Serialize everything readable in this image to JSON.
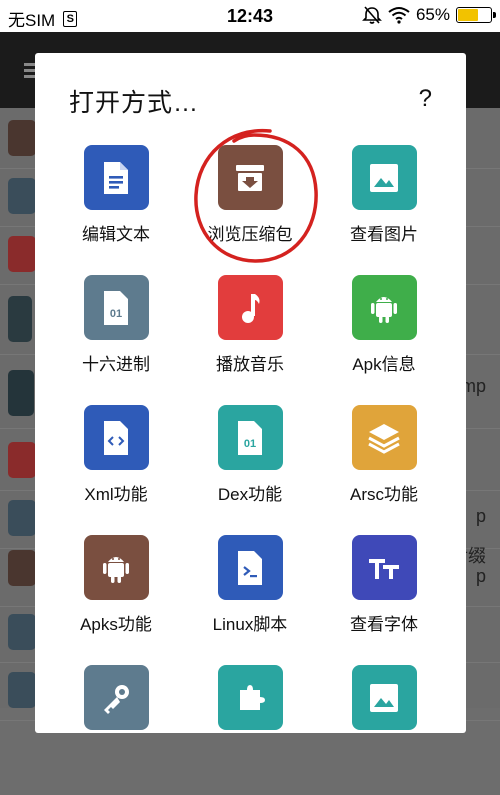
{
  "status_bar": {
    "carrier": "无SIM",
    "sim_badge": "S",
    "time": "12:43",
    "battery_text": "65%",
    "battery_level": 0.65
  },
  "background_app": {
    "partial_texts": [
      "mp",
      "p",
      "后缀",
      "p"
    ]
  },
  "dialog": {
    "title": "打开方式…",
    "help": "?",
    "items": [
      {
        "label": "编辑文本",
        "icon": "document-text-icon",
        "color": "#2f5bb8"
      },
      {
        "label": "浏览压缩包",
        "icon": "archive-icon",
        "color": "#7a4f40"
      },
      {
        "label": "查看图片",
        "icon": "image-icon",
        "color": "#2aa5a0"
      },
      {
        "label": "十六进制",
        "icon": "hex-file-icon",
        "color": "#5e7b8e"
      },
      {
        "label": "播放音乐",
        "icon": "music-note-icon",
        "color": "#e23d3d"
      },
      {
        "label": "Apk信息",
        "icon": "android-icon",
        "color": "#3fae4a"
      },
      {
        "label": "Xml功能",
        "icon": "xml-code-icon",
        "color": "#2f5bb8"
      },
      {
        "label": "Dex功能",
        "icon": "dex-file-icon",
        "color": "#2aa5a0"
      },
      {
        "label": "Arsc功能",
        "icon": "layers-icon",
        "color": "#e0a43a"
      },
      {
        "label": "Apks功能",
        "icon": "android-icon",
        "color": "#7a4f40"
      },
      {
        "label": "Linux脚本",
        "icon": "terminal-script-icon",
        "color": "#2f5bb8"
      },
      {
        "label": "查看字体",
        "icon": "font-icon",
        "color": "#3f49b8"
      },
      {
        "label": "",
        "icon": "key-icon",
        "color": "#5e7b8e"
      },
      {
        "label": "",
        "icon": "puzzle-icon",
        "color": "#2aa5a0"
      },
      {
        "label": "",
        "icon": "image-icon",
        "color": "#2aa5a0"
      }
    ]
  }
}
